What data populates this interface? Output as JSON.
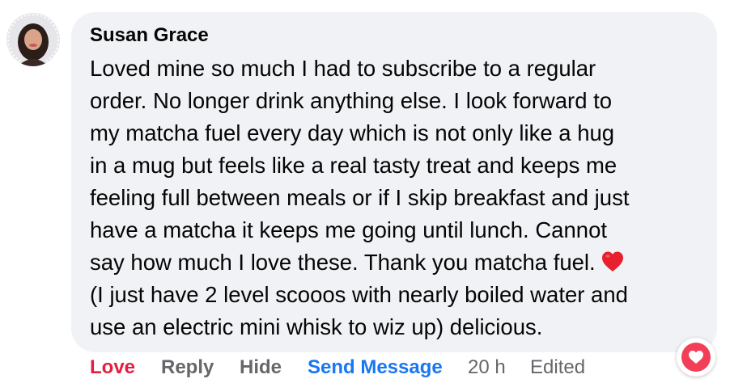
{
  "comment": {
    "author": "Susan Grace",
    "avatar_icon": "profile-photo",
    "lines": [
      "Loved mine so much I had to subscribe to a regular",
      "order. No longer drink anything else. I look forward to",
      "my matcha fuel every day which is not only like a hug",
      "in a mug but feels like a real tasty treat and keeps me",
      "feeling full between meals or if I skip breakfast and just",
      "have a matcha it keeps me going until lunch. Cannot",
      "say how much I love these. Thank you matcha fuel.",
      "(I just have 2 level scooos with nearly boiled water and",
      "use an electric mini whisk to wiz up) delicious."
    ],
    "emoji_icon": "red-heart-emoji"
  },
  "actions": {
    "love": "Love",
    "reply": "Reply",
    "hide": "Hide",
    "send_message": "Send Message",
    "time": "20 h",
    "edited": "Edited"
  },
  "reaction": {
    "icon": "love-reaction-icon"
  },
  "colors": {
    "bubble": "#f0f2f5",
    "love": "#e41e3f",
    "link": "#1877f2",
    "muted": "#65676b",
    "reaction": "#f33e58"
  }
}
